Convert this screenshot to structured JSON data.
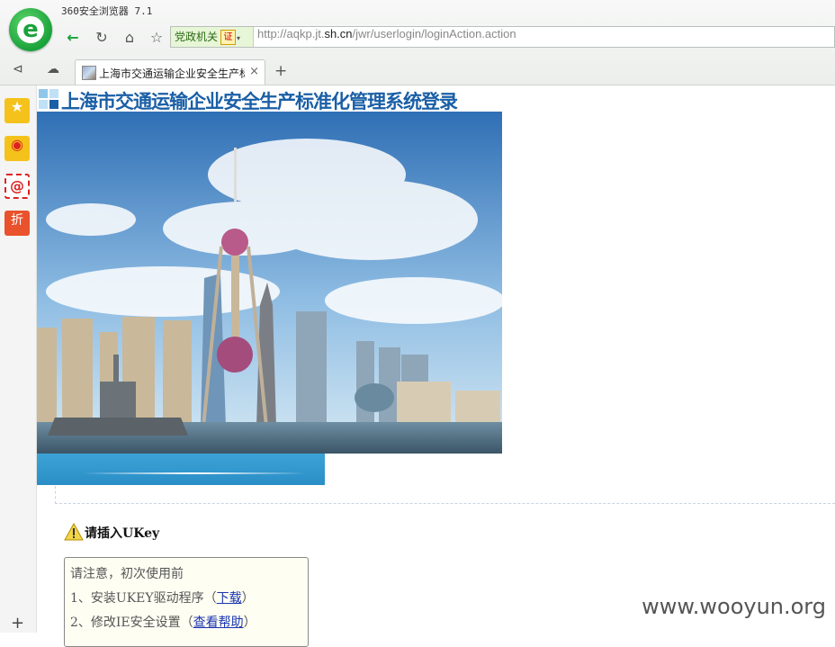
{
  "browser": {
    "app_title": "360安全浏览器 7.1",
    "badge_label": "党政机关",
    "badge_seal": "证",
    "url_prefix": "http://aqkp.jt.",
    "url_domain": "sh.cn",
    "url_suffix": "/jwr/userlogin/loginAction.action",
    "tab_title": "上海市交通运输企业安全生产标",
    "tab_close": "×",
    "new_tab": "+"
  },
  "sidebar": {
    "items": [
      {
        "name": "favorites",
        "glyph": "★"
      },
      {
        "name": "weibo",
        "glyph": "◉"
      },
      {
        "name": "mail",
        "glyph": "@"
      },
      {
        "name": "discount",
        "glyph": "折"
      }
    ],
    "add": "+"
  },
  "page": {
    "title": "上海市交通运输企业安全生产标准化管理系统登录",
    "warning": "请插入UKey",
    "notice": {
      "line1": "请注意，初次使用前",
      "line2_prefix": "1、安装UKEY驱动程序（",
      "line2_link": "下载",
      "line2_suffix": "）",
      "line3_prefix": "2、修改IE安全设置（",
      "line3_link": "查看帮助",
      "line3_suffix": "）"
    }
  },
  "watermark": "www.wooyun.org",
  "colors": {
    "title_blue": "#1a5fa6",
    "bar_blue": "#2a8ec6",
    "link_blue": "#1a34b0"
  }
}
